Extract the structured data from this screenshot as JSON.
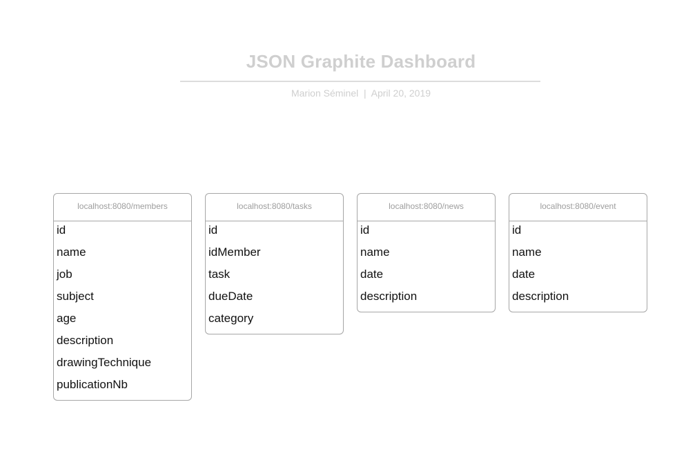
{
  "header": {
    "title": "JSON Graphite Dashboard",
    "subtitle": "Marion Séminel  |  April 20, 2019"
  },
  "entities": [
    {
      "source": "localhost:8080/members",
      "fields": [
        "id",
        "name",
        "job",
        "subject",
        "age",
        "description",
        "drawingTechnique",
        "publicationNb"
      ]
    },
    {
      "source": "localhost:8080/tasks",
      "fields": [
        "id",
        "idMember",
        "task",
        "dueDate",
        "category"
      ]
    },
    {
      "source": "localhost:8080/news",
      "fields": [
        "id",
        "name",
        "date",
        "description"
      ]
    },
    {
      "source": "localhost:8080/event",
      "fields": [
        "id",
        "name",
        "date",
        "description"
      ]
    }
  ],
  "colors": {
    "title": "#cfcfcf",
    "border": "#a6a6a6",
    "header_text": "#9d9d9d",
    "field_text": "#111111"
  }
}
